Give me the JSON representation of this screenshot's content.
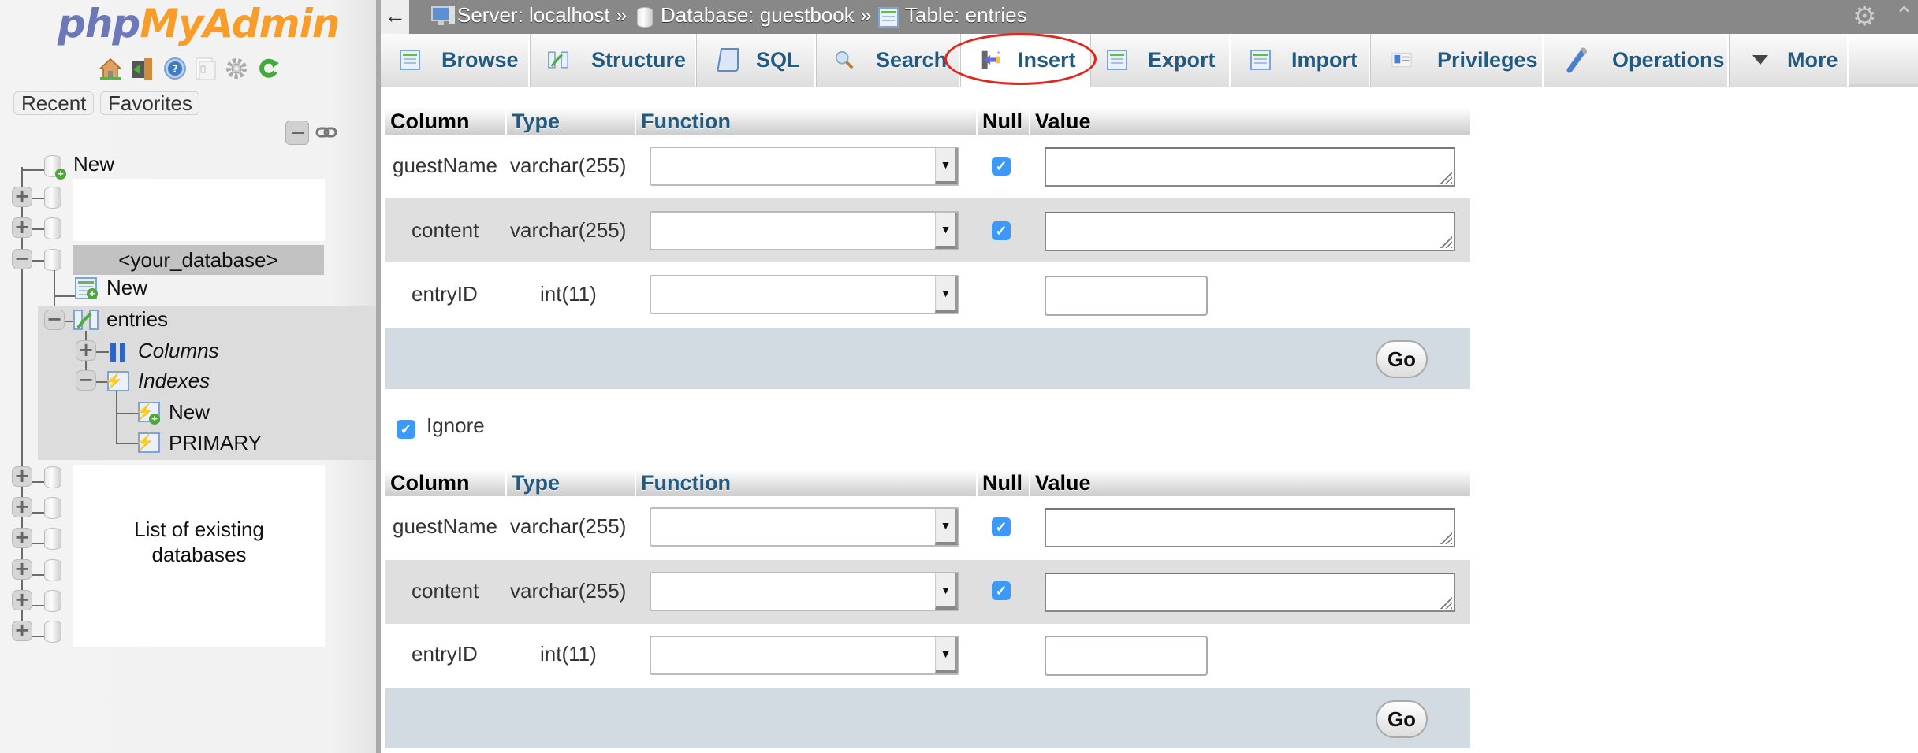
{
  "sidebar": {
    "logo": {
      "php": "php",
      "myadmin": "MyAdmin"
    },
    "nav_icons": [
      "home-icon",
      "logout-icon",
      "help-icon",
      "docs-icon",
      "settings-icon",
      "reload-icon"
    ],
    "buttons": {
      "recent": "Recent",
      "favorites": "Favorites"
    },
    "tree": {
      "new_db": "New",
      "current_db": "<your_database>",
      "new_table": "New",
      "table": "entries",
      "columns": "Columns",
      "indexes": "Indexes",
      "new_index": "New",
      "primary": "PRIMARY",
      "db_list_note": "List of existing databases"
    }
  },
  "topbar": {
    "back": "←",
    "breadcrumb": [
      {
        "label": "Server: localhost »",
        "icon": "server-icon"
      },
      {
        "label": "Database: guestbook »",
        "icon": "database-icon"
      },
      {
        "label": "Table: entries",
        "icon": "table-icon"
      }
    ]
  },
  "tabs": [
    {
      "label": "Browse",
      "icon": "browse-icon"
    },
    {
      "label": "Structure",
      "icon": "structure-icon"
    },
    {
      "label": "SQL",
      "icon": "sql-icon"
    },
    {
      "label": "Search",
      "icon": "search-icon"
    },
    {
      "label": "Insert",
      "icon": "insert-icon",
      "active": true
    },
    {
      "label": "Export",
      "icon": "export-icon"
    },
    {
      "label": "Import",
      "icon": "import-icon"
    },
    {
      "label": "Privileges",
      "icon": "privileges-icon"
    },
    {
      "label": "Operations",
      "icon": "operations-icon"
    },
    {
      "label": "More",
      "icon": "dropdown-triangle-icon"
    }
  ],
  "insert_form": {
    "headers": [
      "Column",
      "Type",
      "Function",
      "Null",
      "Value"
    ],
    "rows": [
      {
        "column": "guestName",
        "type": "varchar(255)",
        "function": "",
        "null_checked": true,
        "value": ""
      },
      {
        "column": "content",
        "type": "varchar(255)",
        "function": "",
        "null_checked": true,
        "value": ""
      },
      {
        "column": "entryID",
        "type": "int(11)",
        "function": "",
        "null_checked": false,
        "value": ""
      }
    ],
    "go_label": "Go",
    "ignore_label": "Ignore",
    "ignore_checked": true,
    "check_glyph": "✓"
  },
  "colors": {
    "accent_tab_text": "#235a81",
    "highlight_ellipse": "#e1261c",
    "checkbox": "#3b99fc"
  }
}
